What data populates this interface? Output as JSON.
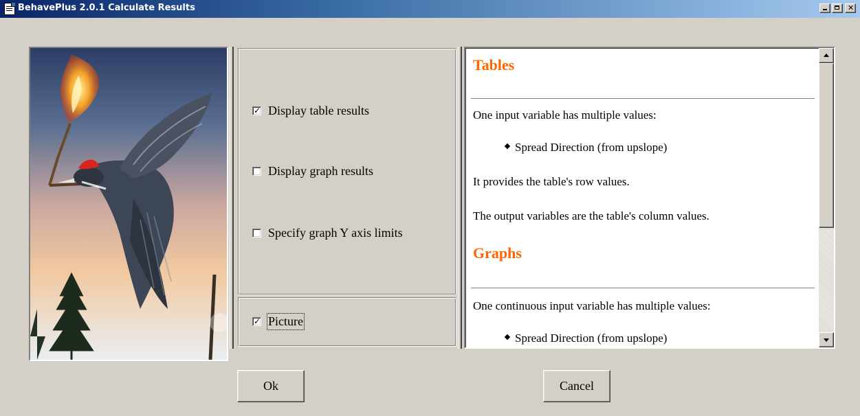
{
  "window": {
    "title": "BehavePlus 2.0.1 Calculate Results",
    "controls": {
      "minimize": "_",
      "maximize": "□",
      "close": "×"
    }
  },
  "picture": {
    "description_icon": "bird-with-fire-icon",
    "colors": {
      "sky_top": "#2c3e66",
      "sky_mid": "#e7b79a",
      "sky_low": "#f6d4a4",
      "flame": "#f4a22b"
    }
  },
  "options": {
    "display_table": {
      "label": "Display table results",
      "checked": true
    },
    "display_graph": {
      "label": "Display graph results",
      "checked": false
    },
    "specify_y_limits": {
      "label": "Specify graph Y axis limits",
      "checked": false
    },
    "picture": {
      "label": "Picture",
      "checked": true
    }
  },
  "help": {
    "tables_heading": "Tables",
    "tables_line1": "One input variable has multiple values:",
    "tables_bullet1": "Spread Direction (from upslope)",
    "tables_line2": "It provides the table's row values.",
    "tables_line3": "The output variables are the table's column values.",
    "graphs_heading": "Graphs",
    "graphs_line1": "One continuous input variable has multiple values:",
    "graphs_bullet1": "Spread Direction (from upslope)",
    "heading_color": "#ff6600"
  },
  "buttons": {
    "ok": "Ok",
    "cancel": "Cancel"
  }
}
